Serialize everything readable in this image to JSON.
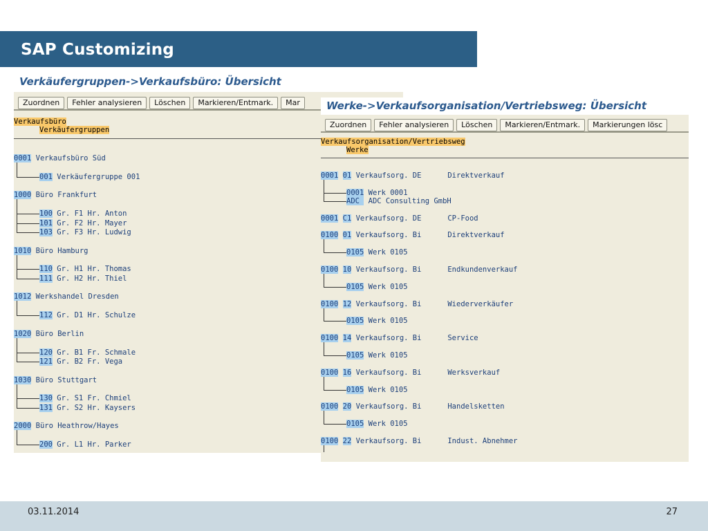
{
  "slide": {
    "title": "SAP Customizing",
    "date": "03.11.2014",
    "page_number": "27"
  },
  "window1": {
    "title": "Verkäufergruppen->Verkaufsbüro: Übersicht",
    "buttons": [
      "Zuordnen",
      "Fehler analysieren",
      "Löschen",
      "Markieren/Entmark.",
      "Mar"
    ],
    "legend_top": "Verkaufsbüro",
    "legend_sub": "Verkäufergruppen",
    "offices": [
      {
        "code": "0001",
        "name": "Verkaufsbüro Süd",
        "groups": [
          {
            "code": "001",
            "name": "Verkäufergruppe 001"
          }
        ]
      },
      {
        "code": "1000",
        "name": "Büro Frankfurt",
        "groups": [
          {
            "code": "100",
            "name": "Gr. F1 Hr. Anton"
          },
          {
            "code": "101",
            "name": "Gr. F2 Hr. Mayer"
          },
          {
            "code": "103",
            "name": "Gr. F3 Hr. Ludwig"
          }
        ]
      },
      {
        "code": "1010",
        "name": "Büro Hamburg",
        "groups": [
          {
            "code": "110",
            "name": "Gr. H1 Hr. Thomas"
          },
          {
            "code": "111",
            "name": "Gr. H2 Hr. Thiel"
          }
        ]
      },
      {
        "code": "1012",
        "name": "Werkshandel Dresden",
        "groups": [
          {
            "code": "112",
            "name": "Gr. D1 Hr. Schulze"
          }
        ]
      },
      {
        "code": "1020",
        "name": "Büro Berlin",
        "groups": [
          {
            "code": "120",
            "name": "Gr. B1 Fr. Schmale"
          },
          {
            "code": "121",
            "name": "Gr. B2 Fr. Vega"
          }
        ]
      },
      {
        "code": "1030",
        "name": "Büro Stuttgart",
        "groups": [
          {
            "code": "130",
            "name": "Gr. S1 Fr. Chmiel"
          },
          {
            "code": "131",
            "name": "Gr. S2 Hr. Kaysers"
          }
        ]
      },
      {
        "code": "2000",
        "name": "Büro Heathrow/Hayes",
        "groups": [
          {
            "code": "200",
            "name": "Gr. L1 Hr. Parker"
          }
        ]
      }
    ]
  },
  "window2": {
    "title": "Werke->Verkaufsorganisation/Vertriebsweg: Übersicht",
    "buttons": [
      "Zuordnen",
      "Fehler analysieren",
      "Löschen",
      "Markieren/Entmark.",
      "Markierungen lösc"
    ],
    "legend_top": "Verkaufsorganisation/Vertriebsweg",
    "legend_sub": "Werke",
    "entries": [
      {
        "org": "0001",
        "channel": "01",
        "org_name": "Verkaufsorg. DE",
        "channel_name": "Direktverkauf",
        "plants": [
          {
            "code": "0001",
            "name": "Werk 0001"
          },
          {
            "code": "ADC ",
            "name": "ADC Consulting GmbH"
          }
        ]
      },
      {
        "org": "0001",
        "channel": "C1",
        "org_name": "Verkaufsorg. DE",
        "channel_name": "CP-Food",
        "plants": []
      },
      {
        "org": "0100",
        "channel": "01",
        "org_name": "Verkaufsorg. Bi",
        "channel_name": "Direktverkauf",
        "plants": [
          {
            "code": "0105",
            "name": "Werk 0105"
          }
        ]
      },
      {
        "org": "0100",
        "channel": "10",
        "org_name": "Verkaufsorg. Bi",
        "channel_name": "Endkundenverkauf",
        "plants": [
          {
            "code": "0105",
            "name": "Werk 0105"
          }
        ]
      },
      {
        "org": "0100",
        "channel": "12",
        "org_name": "Verkaufsorg. Bi",
        "channel_name": "Wiederverkäufer",
        "plants": [
          {
            "code": "0105",
            "name": "Werk 0105"
          }
        ]
      },
      {
        "org": "0100",
        "channel": "14",
        "org_name": "Verkaufsorg. Bi",
        "channel_name": "Service",
        "plants": [
          {
            "code": "0105",
            "name": "Werk 0105"
          }
        ]
      },
      {
        "org": "0100",
        "channel": "16",
        "org_name": "Verkaufsorg. Bi",
        "channel_name": "Werksverkauf",
        "plants": [
          {
            "code": "0105",
            "name": "Werk 0105"
          }
        ]
      },
      {
        "org": "0100",
        "channel": "20",
        "org_name": "Verkaufsorg. Bi",
        "channel_name": "Handelsketten",
        "plants": [
          {
            "code": "0105",
            "name": "Werk 0105"
          }
        ]
      },
      {
        "org": "0100",
        "channel": "22",
        "org_name": "Verkaufsorg. Bi",
        "channel_name": "Indust. Abnehmer",
        "plants": []
      }
    ]
  },
  "colors": {
    "title_bar": "#2c5f86",
    "sap_background": "#efecdd",
    "highlight_orange": "#f9c86a",
    "highlight_blue": "#a8d0ee",
    "footer": "#cbd9e1"
  }
}
